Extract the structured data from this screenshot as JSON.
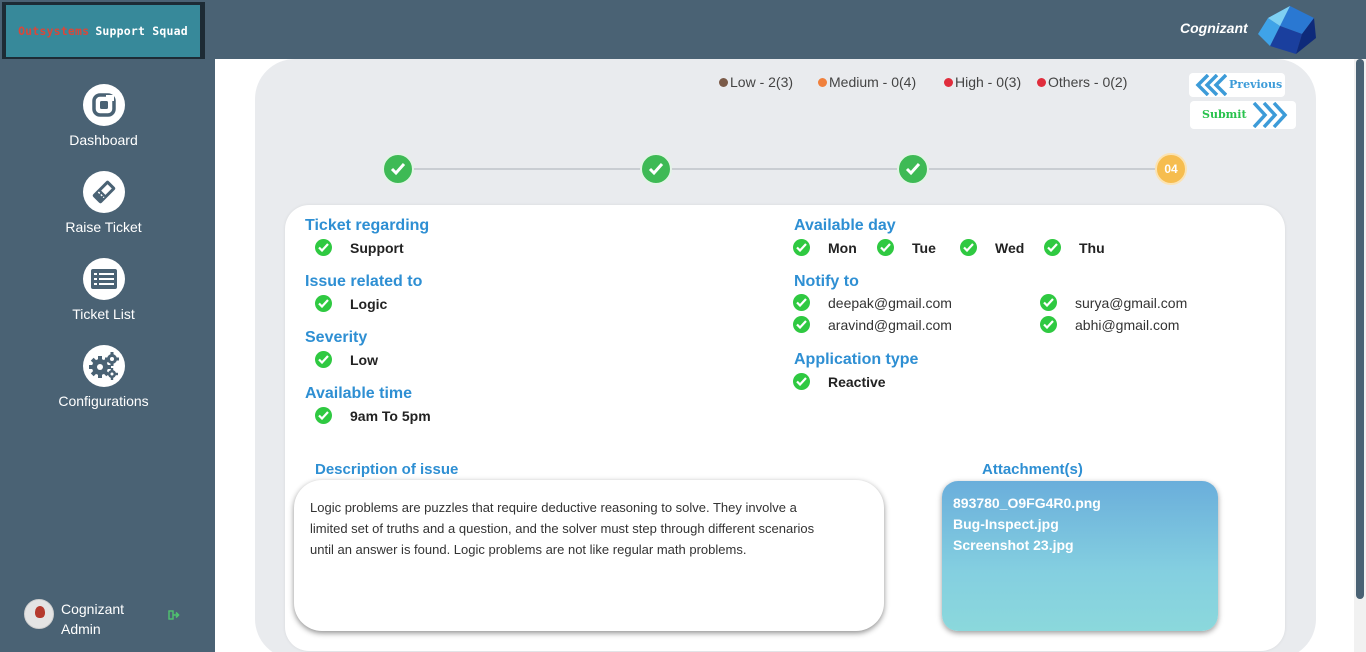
{
  "brand": {
    "part1": "Outsystems",
    "part2": "Support Squad"
  },
  "company": "Cognizant",
  "sidebar": {
    "items": [
      {
        "label": "Dashboard",
        "icon": "dashboard-icon"
      },
      {
        "label": "Raise Ticket",
        "icon": "ticket-icon"
      },
      {
        "label": "Ticket List",
        "icon": "list-icon"
      },
      {
        "label": "Configurations",
        "icon": "gears-icon"
      }
    ],
    "user": {
      "line1": "Cognizant",
      "line2": "Admin"
    }
  },
  "legend": [
    {
      "label": "Low - 2(3)",
      "color": "#7a5a48"
    },
    {
      "label": "Medium - 0(4)",
      "color": "#f0803c"
    },
    {
      "label": "High - 0(3)",
      "color": "#e02d3c"
    },
    {
      "label": "Others - 0(2)",
      "color": "#e02d3c"
    }
  ],
  "buttons": {
    "previous": "Previous",
    "submit": "Submit"
  },
  "stepper": {
    "completed": 3,
    "current_label": "04"
  },
  "ticket": {
    "regarding_label": "Ticket regarding",
    "regarding_value": "Support",
    "issue_label": "Issue related to",
    "issue_value": "Logic",
    "severity_label": "Severity",
    "severity_value": "Low",
    "time_label": "Available time",
    "time_value": "9am To 5pm",
    "day_label": "Available day",
    "days": [
      "Mon",
      "Tue",
      "Wed",
      "Thu"
    ],
    "notify_label": "Notify to",
    "notify": [
      "deepak@gmail.com",
      "surya@gmail.com",
      "aravind@gmail.com",
      "abhi@gmail.com"
    ],
    "apptype_label": "Application type",
    "apptype_value": "Reactive"
  },
  "description": {
    "label": "Description of issue",
    "line1": "Logic problems are puzzles that require deductive reasoning to solve. They involve a",
    "line2": "limited set of truths and a question, and the solver must step through different scenarios",
    "line3": "until an answer is found. Logic problems are not like regular math problems."
  },
  "attachments": {
    "label": "Attachment(s)",
    "files": [
      "893780_O9FG4R0.png",
      "Bug-Inspect.jpg",
      "Screenshot 23.jpg"
    ]
  }
}
